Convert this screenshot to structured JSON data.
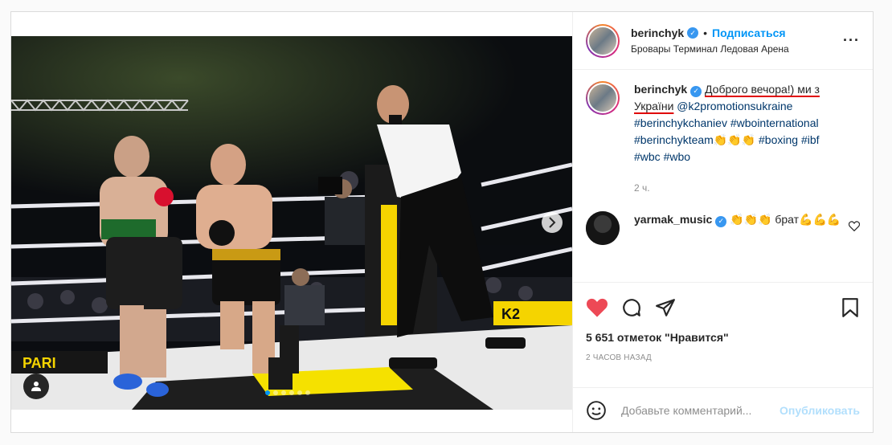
{
  "post": {
    "author": {
      "username": "berinchyk",
      "verified_icon": "verified-badge-icon",
      "separator": "•",
      "follow_label": "Подписаться",
      "location": "Бровары Терминал Ледовая Арена"
    },
    "caption": {
      "username": "berinchyk",
      "text_part1": "Доброго вечора!) ми з",
      "text_part2": "України",
      "mention": "@k2promotionsukraine",
      "hashtags_line1": "#berinchykchaniev #wbointernational",
      "hashtags_line2_tag": "#berinchykteam",
      "emoji_clap": "👏👏👏",
      "hashtags_line2_rest": "#boxing #ibf",
      "hashtags_line3": "#wbc #wbo",
      "time": "2 ч."
    },
    "comment": {
      "username": "yarmak_music",
      "text": "👏👏👏 брат💪💪💪"
    },
    "likes_text": "5 651 отметок \"Нравится\"",
    "ago_text": "2 ЧАСОВ НАЗАД",
    "add_comment": {
      "placeholder": "Добавьте комментарий...",
      "post_label": "Опубликовать"
    },
    "carousel": {
      "total_slides": 6,
      "active_index": 0
    },
    "colors": {
      "accent": "#0095f6",
      "like_red": "#ed4956",
      "annotation_red": "#e00000"
    }
  }
}
